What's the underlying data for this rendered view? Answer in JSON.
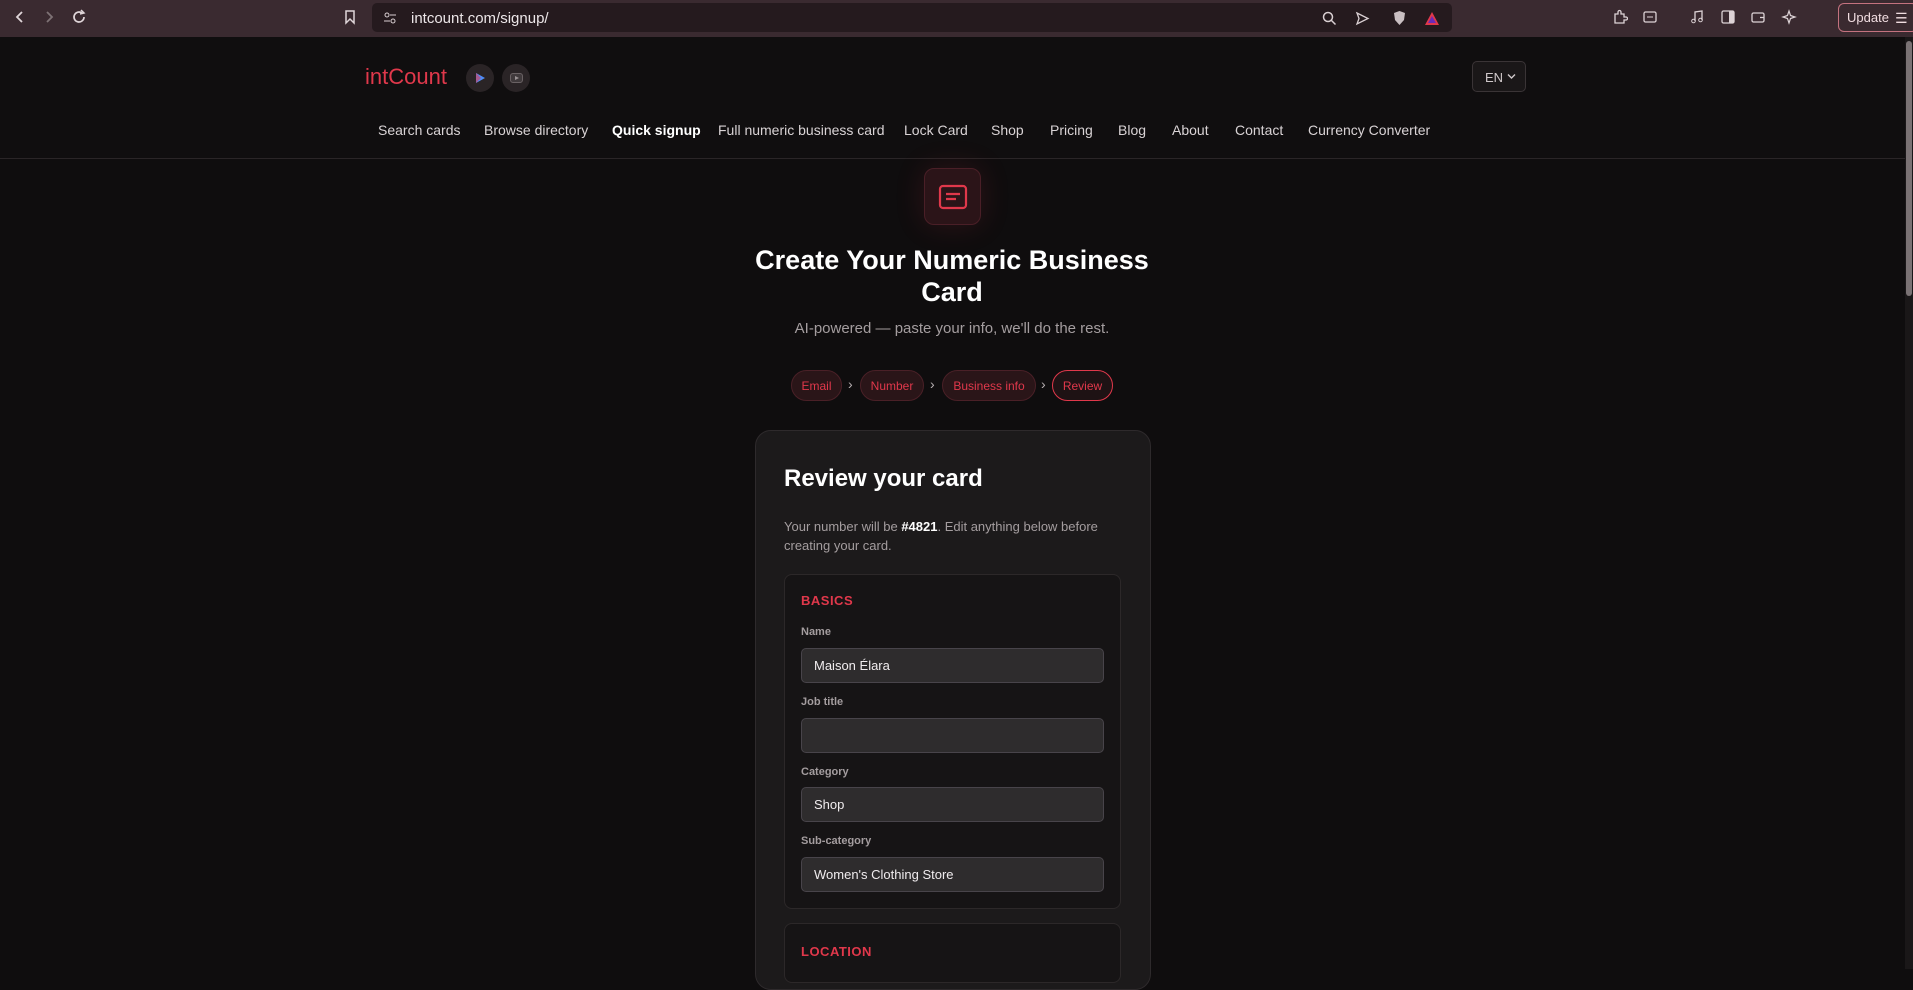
{
  "browser": {
    "url": "intcount.com/signup/",
    "update_label": "Update"
  },
  "header": {
    "logo": "intCount",
    "lang": "EN",
    "nav": [
      "Search cards",
      "Browse directory",
      "Quick signup",
      "Full numeric business card",
      "Lock Card",
      "Shop",
      "Pricing",
      "Blog",
      "About",
      "Contact",
      "Currency Converter"
    ],
    "active_nav": "Quick signup"
  },
  "hero": {
    "title": "Create Your Numeric Business Card",
    "subtitle": "AI-powered — paste your info, we'll do the rest."
  },
  "steps": [
    "Email",
    "Number",
    "Business info",
    "Review"
  ],
  "card": {
    "title": "Review your card",
    "desc_prefix": "Your number will be ",
    "number": "#4821",
    "desc_suffix": ". Edit anything below before creating your card.",
    "basics": {
      "title": "BASICS",
      "fields": [
        {
          "label": "Name",
          "value": "Maison Élara"
        },
        {
          "label": "Job title",
          "value": ""
        },
        {
          "label": "Category",
          "value": "Shop"
        },
        {
          "label": "Sub-category",
          "value": "Women's Clothing Store"
        }
      ]
    },
    "location": {
      "title": "LOCATION"
    }
  },
  "colors": {
    "accent": "#e0384b",
    "background": "#0f0d0e",
    "chrome": "#3a2a30"
  }
}
